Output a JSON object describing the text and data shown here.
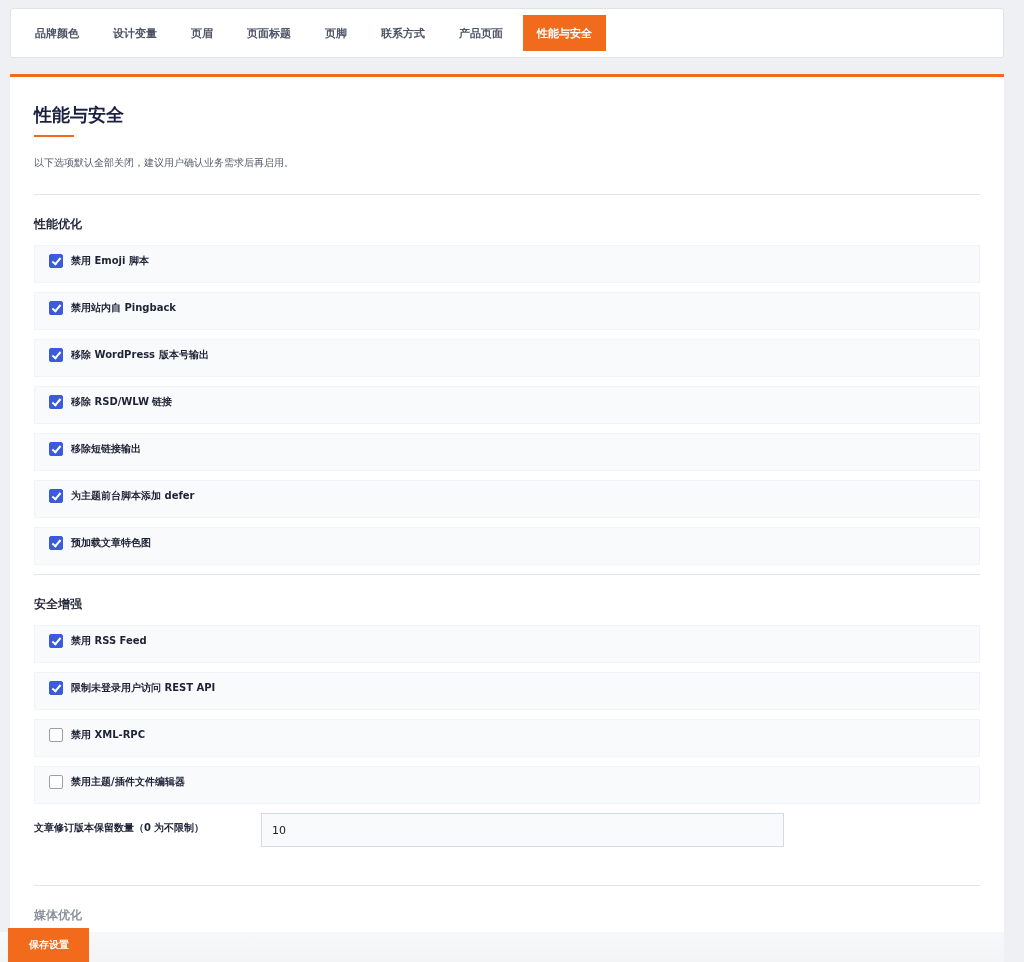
{
  "tabs": [
    {
      "label": "品牌颜色",
      "selected": false
    },
    {
      "label": "设计变量",
      "selected": false
    },
    {
      "label": "页眉",
      "selected": false
    },
    {
      "label": "页面标题",
      "selected": false
    },
    {
      "label": "页脚",
      "selected": false
    },
    {
      "label": "联系方式",
      "selected": false
    },
    {
      "label": "产品页面",
      "selected": false
    },
    {
      "label": "性能与安全",
      "selected": true
    }
  ],
  "panel": {
    "title": "性能与安全",
    "description": "以下选项默认全部关闭，建议用户确认业务需求后再启用。",
    "sections": [
      {
        "heading": "性能优化",
        "options": [
          {
            "label": "禁用 Emoji 脚本",
            "checked": true
          },
          {
            "label": "禁用站内自 Pingback",
            "checked": true
          },
          {
            "label": "移除 WordPress 版本号输出",
            "checked": true
          },
          {
            "label": "移除 RSD/WLW 链接",
            "checked": true
          },
          {
            "label": "移除短链接输出",
            "checked": true
          },
          {
            "label": "为主题前台脚本添加 defer",
            "checked": true
          },
          {
            "label": "预加载文章特色图",
            "checked": true
          }
        ]
      },
      {
        "heading": "安全增强",
        "options": [
          {
            "label": "禁用 RSS Feed",
            "checked": true
          },
          {
            "label": "限制未登录用户访问 REST API",
            "checked": true
          },
          {
            "label": "禁用 XML-RPC",
            "checked": false
          },
          {
            "label": "禁用主题/插件文件编辑器",
            "checked": false
          }
        ],
        "field": {
          "label": "文章修订版本保留数量（0 为不限制）",
          "value": "10"
        }
      },
      {
        "heading": "媒体优化"
      }
    ]
  },
  "save_button": "保存设置"
}
